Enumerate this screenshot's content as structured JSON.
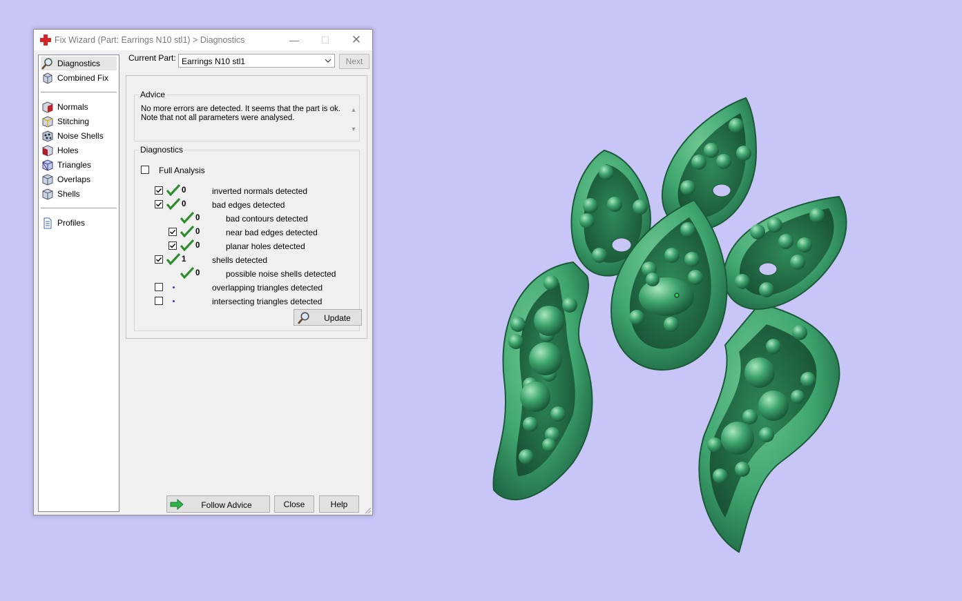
{
  "window": {
    "title": "Fix Wizard (Part: Earrings N10 stl1) > Diagnostics",
    "minimize_glyph": "—",
    "maximize_glyph": "☐",
    "close_glyph": "✕"
  },
  "sidebar": {
    "items": [
      {
        "label": "Diagnostics",
        "icon": "magnifier-icon"
      },
      {
        "label": "Combined Fix",
        "icon": "combined-fix-icon"
      },
      {
        "label": "Normals",
        "icon": "normals-icon"
      },
      {
        "label": "Stitching",
        "icon": "stitching-icon"
      },
      {
        "label": "Noise Shells",
        "icon": "noise-shells-icon"
      },
      {
        "label": "Holes",
        "icon": "holes-icon"
      },
      {
        "label": "Triangles",
        "icon": "triangles-icon"
      },
      {
        "label": "Overlaps",
        "icon": "overlaps-icon"
      },
      {
        "label": "Shells",
        "icon": "shells-icon"
      },
      {
        "label": "Profiles",
        "icon": "profiles-icon"
      }
    ]
  },
  "header": {
    "current_part_label": "Current Part:",
    "current_part_value": "Earrings N10 stl1",
    "next_label": "Next"
  },
  "advice": {
    "legend": "Advice",
    "line1": "No more errors are detected. It seems that the part is ok.",
    "line2": "Note that not all parameters were analysed."
  },
  "diagnostics": {
    "legend": "Diagnostics",
    "full_analysis_label": "Full Analysis",
    "full_analysis_checked": false,
    "rows": [
      {
        "label": "inverted normals detected",
        "count": "0",
        "checked": true,
        "status": "ok"
      },
      {
        "label": "bad edges detected",
        "count": "0",
        "checked": true,
        "status": "ok"
      },
      {
        "label": "bad contours detected",
        "count": "0",
        "checked": null,
        "status": "ok"
      },
      {
        "label": "near bad edges detected",
        "count": "0",
        "checked": true,
        "status": "ok"
      },
      {
        "label": "planar holes detected",
        "count": "0",
        "checked": true,
        "status": "ok"
      },
      {
        "label": "shells detected",
        "count": "1",
        "checked": true,
        "status": "ok"
      },
      {
        "label": "possible noise shells detected",
        "count": "0",
        "checked": null,
        "status": "ok"
      },
      {
        "label": "overlapping triangles detected",
        "count": "",
        "checked": false,
        "status": "not-analysed"
      },
      {
        "label": "intersecting triangles detected",
        "count": "",
        "checked": false,
        "status": "not-analysed"
      }
    ],
    "update_label": "Update"
  },
  "footer": {
    "follow_advice_label": "Follow Advice",
    "close_label": "Close",
    "help_label": "Help"
  },
  "colors": {
    "background": "#c8c5f7",
    "model_green": "#3fa56f",
    "check_green": "#2e8b2e"
  }
}
